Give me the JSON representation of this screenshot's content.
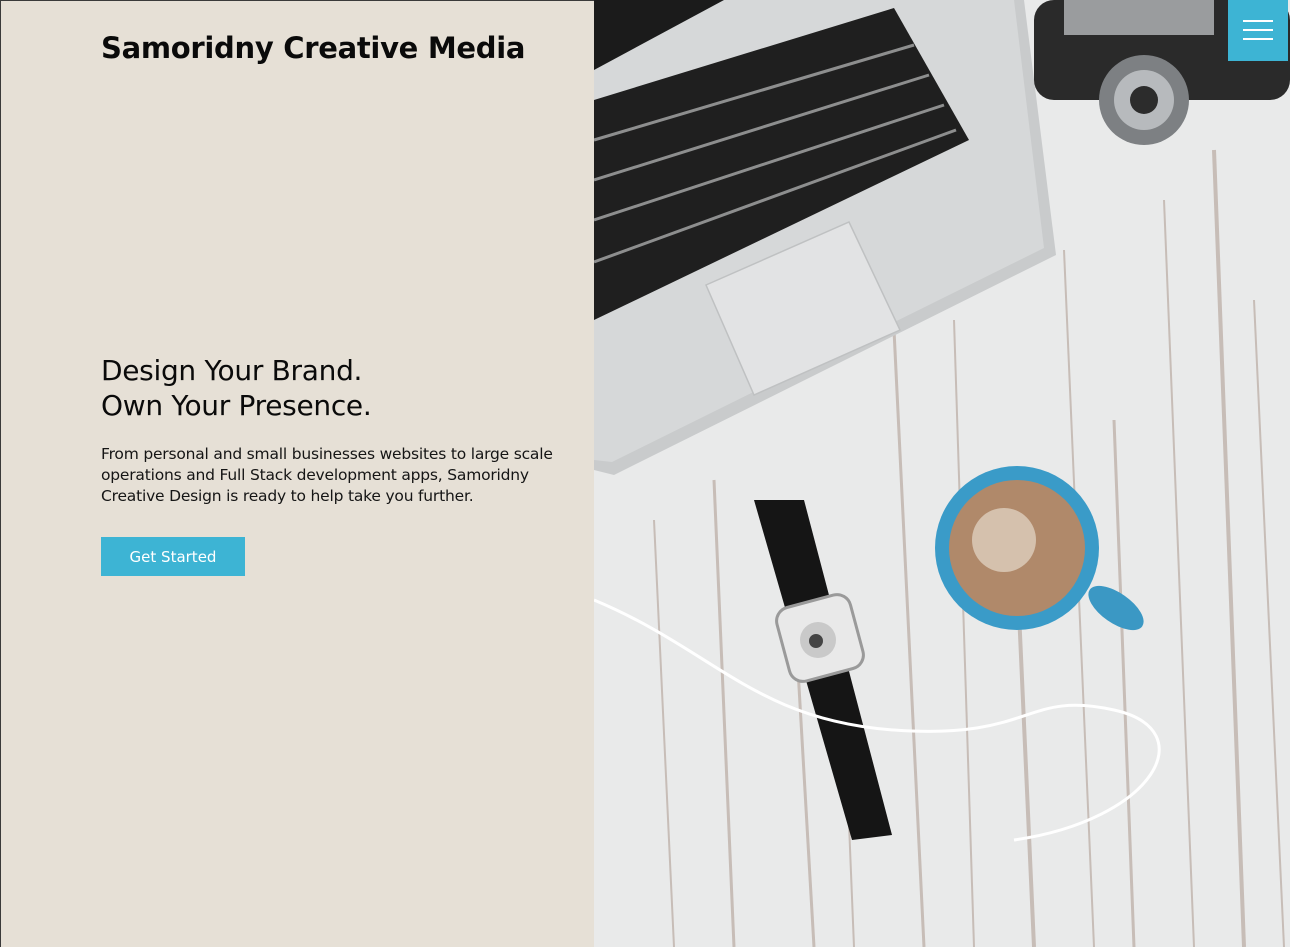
{
  "header": {
    "brand": "Samoridny Creative Media",
    "menu_icon": "hamburger-menu-icon"
  },
  "hero": {
    "heading_line1": "Design Your Brand.",
    "heading_line2": "Own Your Presence.",
    "description": "From personal and small businesses websites to large scale operations and Full Stack development apps, Samoridny Creative Design is ready to help take you further.",
    "cta_label": "Get Started"
  },
  "colors": {
    "accent": "#3db4d4",
    "left_panel_bg": "#e6e0d6",
    "text": "#0a0a0a"
  }
}
